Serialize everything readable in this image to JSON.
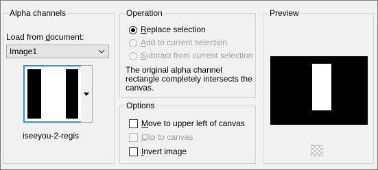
{
  "alpha": {
    "group_title": "Alpha channels",
    "load_label_pre": "Load from ",
    "load_label_u": "d",
    "load_label_post": "ocument:",
    "document_value": "Image1",
    "channel_name": "iseeyou-2-regis"
  },
  "operation": {
    "group_title": "Operation",
    "options": [
      {
        "u": "R",
        "rest": "eplace selection",
        "pre": "",
        "checked": true,
        "enabled": true
      },
      {
        "u": "A",
        "rest": "dd to current selection",
        "pre": "",
        "checked": false,
        "enabled": false
      },
      {
        "u": "S",
        "rest": "ubtract from current selection",
        "pre": "",
        "checked": false,
        "enabled": false
      }
    ],
    "description": "The original alpha channel rectangle completely intersects the canvas."
  },
  "options": {
    "group_title": "Options",
    "items": [
      {
        "u": "M",
        "rest": "ove to upper left of canvas",
        "checked": false,
        "enabled": true
      },
      {
        "u": "C",
        "rest": "lip to canvas",
        "checked": false,
        "enabled": false
      },
      {
        "u": "I",
        "rest": "nvert image",
        "checked": false,
        "enabled": true
      }
    ]
  },
  "preview": {
    "group_title": "Preview"
  }
}
